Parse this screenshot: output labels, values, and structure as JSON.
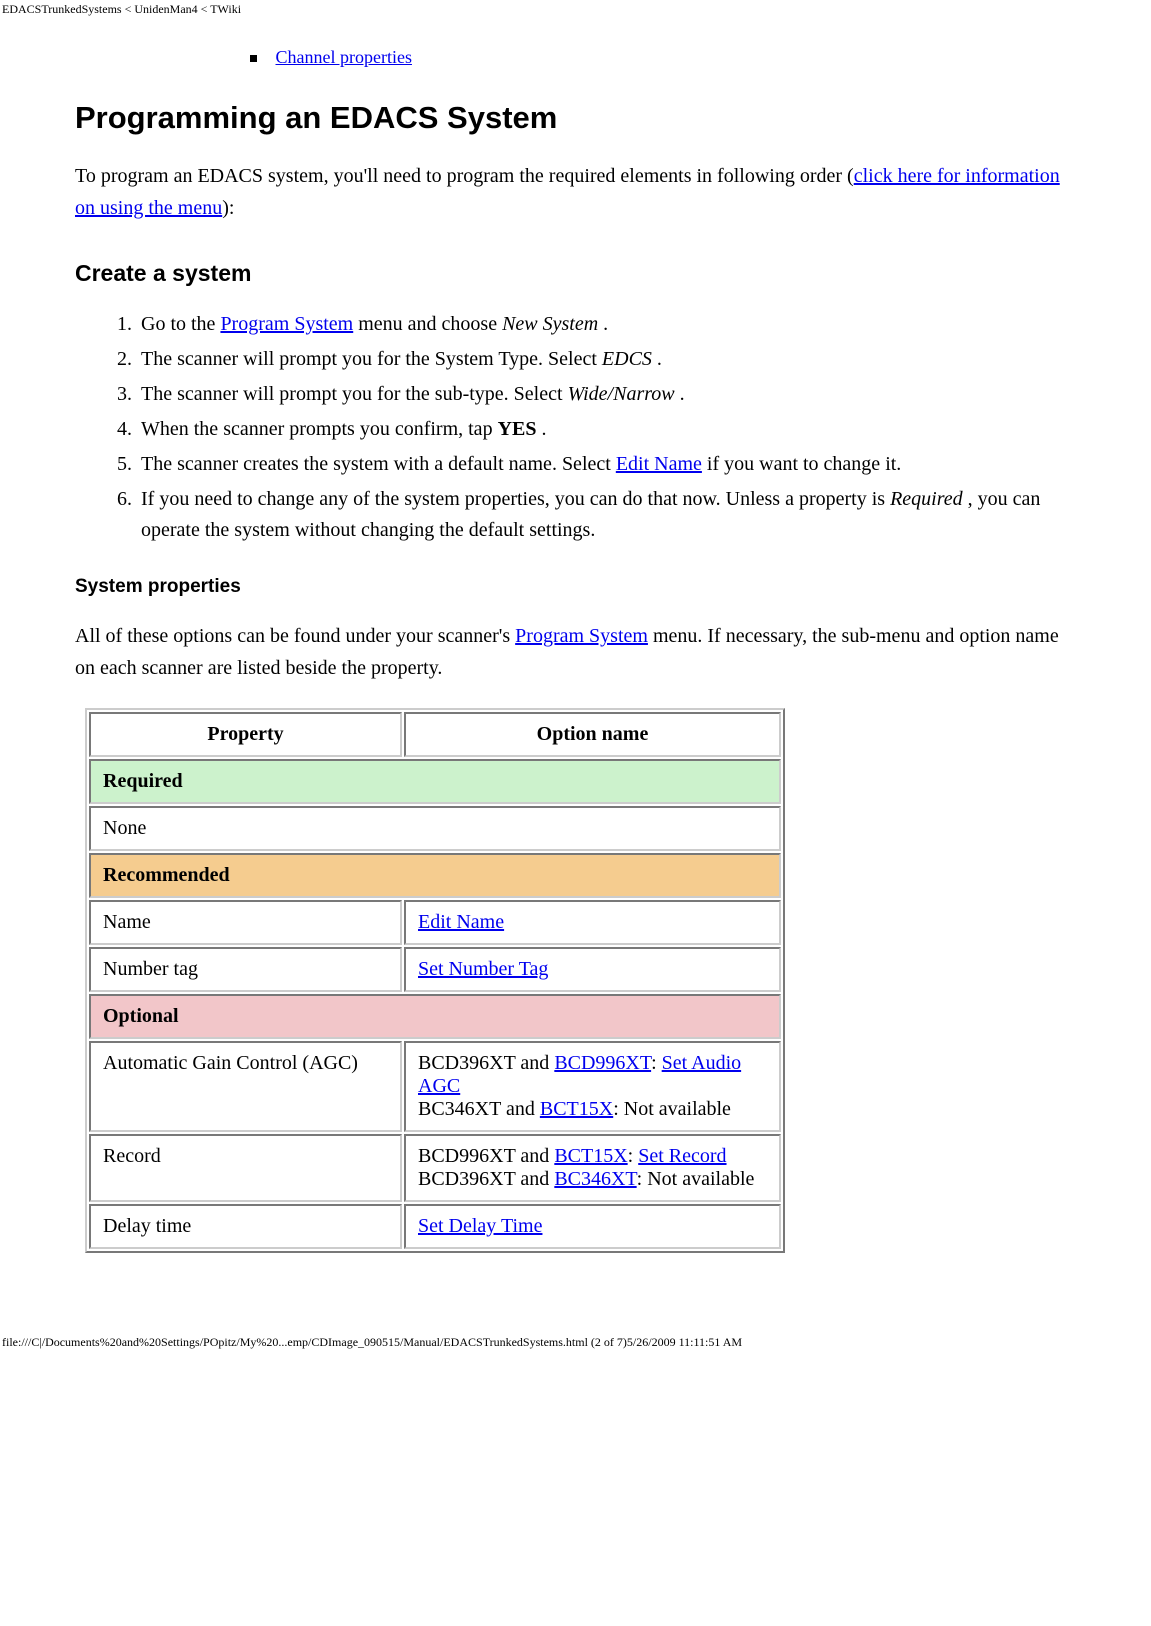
{
  "header": "EDACSTrunkedSystems < UnidenMan4 < TWiki",
  "toc_link": "Channel properties",
  "h1": "Programming an EDACS System",
  "intro": {
    "pre": "To program an EDACS system, you'll need to program the required elements in following order (",
    "link": "click here for information on using the menu",
    "post": "):"
  },
  "h2_create": "Create a system",
  "steps": {
    "s1_pre": "Go to the ",
    "s1_link": "Program System",
    "s1_mid": " menu and choose ",
    "s1_em": "New System",
    "s1_post": " .",
    "s2_pre": "The scanner will prompt you for the System Type. Select ",
    "s2_em": "EDCS",
    "s2_post": " .",
    "s3_pre": "The scanner will prompt you for the sub-type. Select ",
    "s3_em": "Wide/Narrow",
    "s3_post": " .",
    "s4_pre": "When the scanner prompts you confirm, tap ",
    "s4_strong": "YES",
    "s4_post": " .",
    "s5_pre": "The scanner creates the system with a default name. Select ",
    "s5_link": "Edit Name",
    "s5_post": " if you want to change it.",
    "s6_pre": "If you need to change any of the system properties, you can do that now. Unless a property is ",
    "s6_em": "Required",
    "s6_post": " , you can operate the system without changing the default settings."
  },
  "h3_sysprops": "System properties",
  "sysprops_para": {
    "pre": "All of these options can be found under your scanner's ",
    "link": "Program System",
    "post": " menu. If necessary, the sub-menu and option name on each scanner are listed beside the property."
  },
  "table": {
    "col1": "Property",
    "col2": "Option name",
    "sec_required": "Required",
    "none": "None",
    "sec_recommended": "Recommended",
    "name_label": "Name",
    "name_link": "Edit Name",
    "numtag_label": "Number tag",
    "numtag_link": "Set Number Tag",
    "sec_optional": "Optional",
    "agc_label": "Automatic Gain Control (AGC)",
    "agc_l1_pre": "BCD396XT and ",
    "agc_l1_link1": "BCD996XT",
    "agc_l1_mid": ": ",
    "agc_l1_link2": "Set Audio AGC",
    "agc_l2_pre": "BC346XT and ",
    "agc_l2_link": "BCT15X",
    "agc_l2_post": ": Not available",
    "rec_label": "Record",
    "rec_l1_pre": "BCD996XT and ",
    "rec_l1_link1": "BCT15X",
    "rec_l1_mid": ": ",
    "rec_l1_link2": "Set Record",
    "rec_l2_pre": "BCD396XT and ",
    "rec_l2_link": "BC346XT",
    "rec_l2_post": ": Not available",
    "delay_label": "Delay time",
    "delay_link": "Set Delay Time"
  },
  "footer": "file:///C|/Documents%20and%20Settings/POpitz/My%20...emp/CDImage_090515/Manual/EDACSTrunkedSystems.html (2 of 7)5/26/2009 11:11:51 AM"
}
